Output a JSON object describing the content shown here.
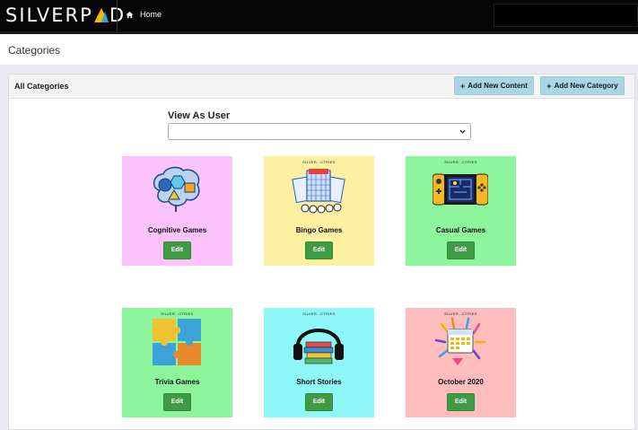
{
  "brand": {
    "text_left": "SILVERP",
    "text_right": "D"
  },
  "nav": {
    "home_label": "Home"
  },
  "page": {
    "title": "Categories"
  },
  "panel": {
    "title": "All Categories",
    "add_content_label": "Add New Content",
    "add_category_label": "Add New Category"
  },
  "view_as_user": {
    "label": "View As User",
    "selected": ""
  },
  "cards": [
    {
      "name": "Cognitive Games",
      "edit_label": "Edit",
      "color": "#fbc2fb",
      "icon": "brain-shapes-icon",
      "stamp": ""
    },
    {
      "name": "Bingo Games",
      "edit_label": "Edit",
      "color": "#fdf0a2",
      "icon": "bingo-card-icon",
      "stamp": "SILVER...CTRIES"
    },
    {
      "name": "Casual Games",
      "edit_label": "Edit",
      "color": "#8df59c",
      "icon": "handheld-console-icon",
      "stamp": "SILVER...CTRIES"
    },
    {
      "name": "Trivia Games",
      "edit_label": "Edit",
      "color": "#8df59c",
      "icon": "puzzle-pieces-icon",
      "stamp": "SILVER...CTRIES"
    },
    {
      "name": "Short Stories",
      "edit_label": "Edit",
      "color": "#8ef7f7",
      "icon": "headphones-books-icon",
      "stamp": "SILVER...CTRIES"
    },
    {
      "name": "October 2020",
      "edit_label": "Edit",
      "color": "#fdbdbd",
      "icon": "calendar-burst-icon",
      "stamp": "SILVER...CTRIES"
    }
  ]
}
